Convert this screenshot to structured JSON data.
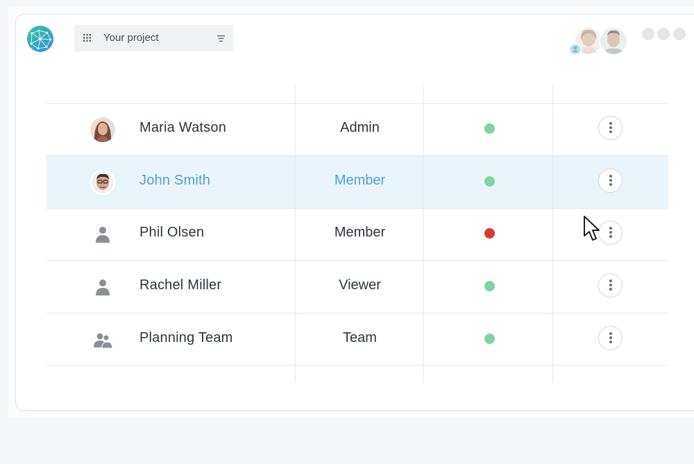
{
  "header": {
    "project_name": "Your project",
    "logo_icon": "globe-network-logo",
    "grid_icon": "apps-grid-icon",
    "menu_icon": "hamburger-lines-icon"
  },
  "members": [
    {
      "name": "Maria Watson",
      "role": "Admin",
      "status": "online",
      "avatar": "photo",
      "menu_icon": "more-vertical-icon"
    },
    {
      "name": "John Smith",
      "role": "Member",
      "status": "online",
      "avatar": "photo",
      "menu_icon": "more-vertical-icon",
      "highlighted": true
    },
    {
      "name": "Phil Olsen",
      "role": "Member",
      "status": "offline",
      "avatar": "person-icon",
      "menu_icon": "more-vertical-icon"
    },
    {
      "name": "Rachel Miller",
      "role": "Viewer",
      "status": "online",
      "avatar": "person-icon",
      "menu_icon": "more-vertical-icon"
    },
    {
      "name": "Planning Team",
      "role": "Team",
      "status": "online",
      "avatar": "group-icon",
      "menu_icon": "more-vertical-icon"
    }
  ],
  "colors": {
    "status_online": "#7ed3a1",
    "status_offline": "#d63a34",
    "highlight_row": "#eaf4fb",
    "highlight_text": "#4ba3d9",
    "text": "#2d3440"
  }
}
